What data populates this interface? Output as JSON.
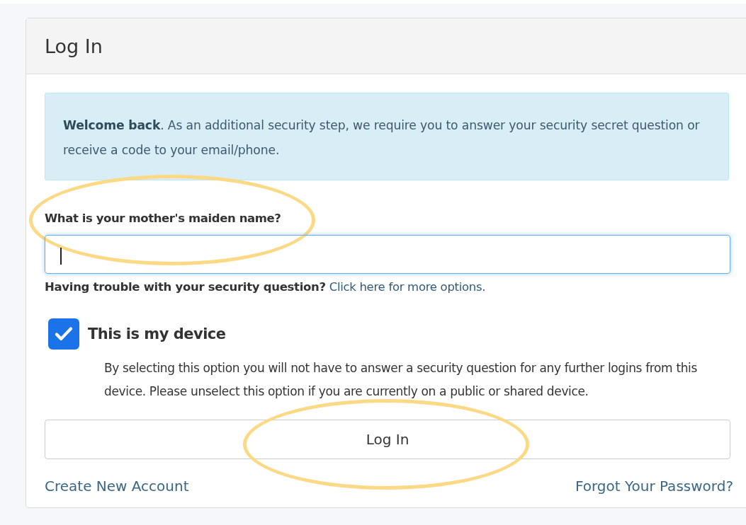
{
  "card": {
    "title": "Log In"
  },
  "alert": {
    "text": "**Welcome back**. As an additional security step, we require you to answer your security secret question or receive a code to your email/phone."
  },
  "question": {
    "label": "What is your mother's maiden name?",
    "circled": true
  },
  "answer": {
    "focused": true
  },
  "help": {
    "lead": "Having trouble with your security question?",
    "link": "Click here for more options."
  },
  "device": {
    "label": "This is my device",
    "checked": true,
    "description": "By selecting this option you will not have to answer a security question for any further logins from this device. Please unselect this option if you are currently on a public or shared device."
  },
  "login_button": {
    "label": "Log In",
    "circled": true
  },
  "links": [
    {
      "label": "Create New Account"
    },
    {
      "label": "Forgot Your Password?"
    }
  ]
}
